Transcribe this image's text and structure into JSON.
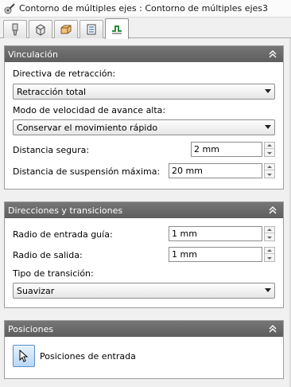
{
  "window": {
    "title": "Contorno de múltiples ejes : Contorno de múltiples ejes3"
  },
  "tabs": [
    {
      "name": "tool-tab",
      "icon": "tool-icon"
    },
    {
      "name": "geometry-tab",
      "icon": "geometry-icon"
    },
    {
      "name": "heights-tab",
      "icon": "heights-icon"
    },
    {
      "name": "passes-tab",
      "icon": "passes-icon"
    },
    {
      "name": "linking-tab",
      "icon": "linking-icon",
      "active": true
    }
  ],
  "vinculacion": {
    "header": "Vinculación",
    "retract_label": "Directiva de retracción:",
    "retract_value": "Retracción total",
    "feed_label": "Modo de velocidad de avance alta:",
    "feed_value": "Conservar el movimiento rápido",
    "safe_label": "Distancia segura:",
    "safe_value": "2 mm",
    "stay_label": "Distancia de suspensión máxima:",
    "stay_value": "20 mm"
  },
  "direcciones": {
    "header": "Direcciones y transiciones",
    "lead_in_label": "Radio de entrada guía:",
    "lead_in_value": "1 mm",
    "lead_out_label": "Radio de salida:",
    "lead_out_value": "1 mm",
    "transition_label": "Tipo de transición:",
    "transition_value": "Suavizar"
  },
  "posiciones": {
    "header": "Posiciones",
    "entry_label": "Posiciones de entrada"
  },
  "colors": {
    "header_bg": "#6a6a6a",
    "accent_blue": "#5b8fc6"
  }
}
